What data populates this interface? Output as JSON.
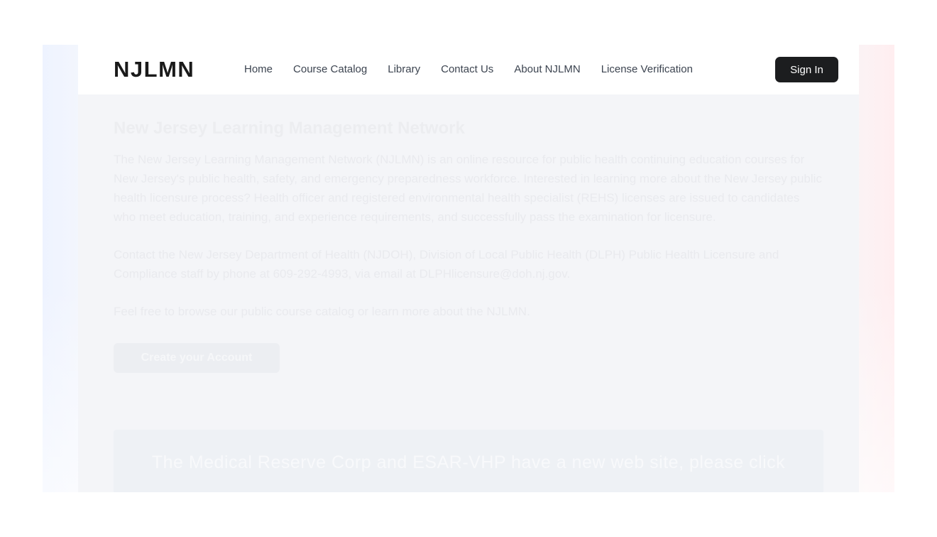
{
  "header": {
    "logo": "NJLMN",
    "nav": [
      {
        "label": "Home"
      },
      {
        "label": "Course Catalog"
      },
      {
        "label": "Library"
      },
      {
        "label": "Contact Us"
      },
      {
        "label": "About NJLMN"
      },
      {
        "label": "License Verification"
      }
    ],
    "signin_label": "Sign In"
  },
  "main": {
    "title": "New Jersey Learning Management Network",
    "para1": "The New Jersey Learning Management Network (NJLMN) is an online resource for public health continuing education courses for New Jersey's public health, safety, and emergency preparedness workforce. Interested in learning more about the New Jersey public health licensure process? Health officer and registered environmental health specialist (REHS) licenses are issued to candidates who meet education, training, and experience requirements, and successfully pass the examination for licensure.",
    "para2": "Contact the New Jersey Department of Health (NJDOH), Division of Local Public Health (DLPH) Public Health Licensure and Compliance staff by phone at 609-292-4993, via email at DLPHlicensure@doh.nj.gov.",
    "para3": "Feel free to browse our public course catalog or learn more about the NJLMN.",
    "cta_label": "Create your Account",
    "banner_text": "The Medical Reserve Corp and ESAR-VHP have a new web site, please click"
  },
  "colors": {
    "signin_bg": "#1c1d1f",
    "logo": "#1a1a1a",
    "nav_text": "#3c4450"
  }
}
